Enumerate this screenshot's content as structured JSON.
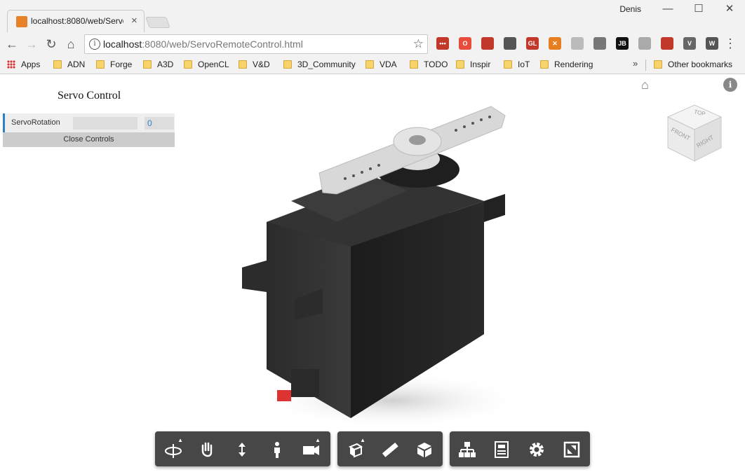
{
  "browser": {
    "tab_title": "localhost:8080/web/ServoRemoteControl.html",
    "tab_close": "×",
    "user_name": "Denis",
    "window_controls": {
      "minimize": "—",
      "maximize": "☐",
      "close": "✕"
    },
    "address": {
      "host": "localhost",
      "path": ":8080/web/ServoRemoteControl.html"
    },
    "extensions": [
      {
        "name": "ext-dots-icon",
        "label": "•••",
        "color": "#c0392b"
      },
      {
        "name": "ext-opera-icon",
        "label": "O",
        "color": "#e74c3c"
      },
      {
        "name": "ext-avatar-icon",
        "label": "",
        "color": "#c0392b"
      },
      {
        "name": "ext-pocket-icon",
        "label": "",
        "color": "#555555"
      },
      {
        "name": "ext-gl-icon",
        "label": "GL",
        "color": "#c0392b"
      },
      {
        "name": "ext-orange-icon",
        "label": "✕",
        "color": "#e67e22"
      },
      {
        "name": "ext-circle-icon",
        "label": "",
        "color": "#bbbbbb"
      },
      {
        "name": "ext-download-icon",
        "label": "",
        "color": "#777777"
      },
      {
        "name": "ext-jb-icon",
        "label": "JB",
        "color": "#111111"
      },
      {
        "name": "ext-gray-icon",
        "label": "",
        "color": "#aaaaaa"
      },
      {
        "name": "ext-cube-icon",
        "label": "",
        "color": "#c0392b"
      },
      {
        "name": "ext-v-icon",
        "label": "V",
        "color": "#666666"
      },
      {
        "name": "ext-w-icon",
        "label": "W",
        "color": "#555555"
      }
    ],
    "bookmarks": [
      {
        "label": "Apps",
        "type": "apps"
      },
      {
        "label": "ADN",
        "type": "folder"
      },
      {
        "label": "Forge",
        "type": "folder"
      },
      {
        "label": "A3D",
        "type": "folder"
      },
      {
        "label": "OpenCL",
        "type": "folder"
      },
      {
        "label": "V&D",
        "type": "folder"
      },
      {
        "label": "3D_Community",
        "type": "folder"
      },
      {
        "label": "VDA",
        "type": "folder"
      },
      {
        "label": "TODO",
        "type": "folder"
      },
      {
        "label": "Inspir",
        "type": "folder"
      },
      {
        "label": "IoT",
        "type": "folder"
      },
      {
        "label": "Rendering",
        "type": "folder"
      }
    ],
    "bookmarks_overflow": "»",
    "other_bookmarks": "Other bookmarks"
  },
  "panel": {
    "title": "Servo Control",
    "control_label": "ServoRotation",
    "control_value": "0",
    "close_label": "Close Controls"
  },
  "viewcube": {
    "top": "TOP",
    "front": "FRONT",
    "right": "RIGHT"
  },
  "toolbar_groups": [
    {
      "name": "navigation-tools",
      "tools": [
        "orbit-icon",
        "pan-icon",
        "zoom-icon",
        "first-person-icon",
        "camera-icon"
      ]
    },
    {
      "name": "model-tools",
      "tools": [
        "explode-icon",
        "measure-icon",
        "section-icon"
      ]
    },
    {
      "name": "settings-tools",
      "tools": [
        "model-browser-icon",
        "properties-icon",
        "settings-icon",
        "fullscreen-icon"
      ]
    }
  ]
}
